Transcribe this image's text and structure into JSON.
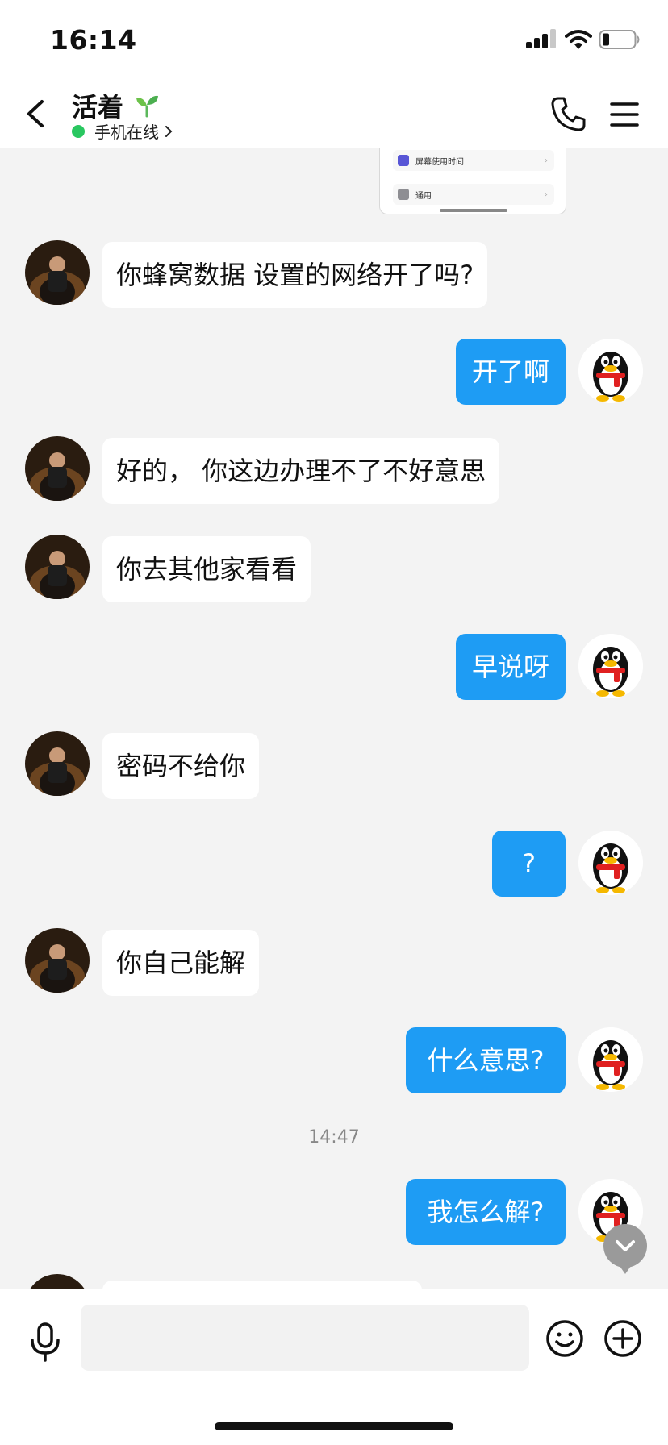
{
  "status_bar": {
    "time": "16:14"
  },
  "header": {
    "title": "活着",
    "subtitle": "手机在线"
  },
  "screenshot_preview": {
    "items": [
      "屏幕使用时间",
      "通用"
    ]
  },
  "chat": {
    "messages": [
      {
        "side": "left",
        "text": "你蜂窝数据  设置的网络开了吗?"
      },
      {
        "side": "right",
        "text": "开了啊"
      },
      {
        "side": "left",
        "text": " 好的，  你这边办理不了不好意思"
      },
      {
        "side": "left",
        "text": "你去其他家看看"
      },
      {
        "side": "right",
        "text": "早说呀"
      },
      {
        "side": "left",
        "text": "密码不给你"
      },
      {
        "side": "right",
        "text": "?"
      },
      {
        "side": "left",
        "text": " 你自己能解"
      },
      {
        "side": "right",
        "text": "什么意思?"
      },
      {
        "side": "right",
        "text": "我怎么解?"
      }
    ],
    "timestamp": "14:47"
  },
  "input": {
    "placeholder": ""
  },
  "icons": {
    "back": "chevron-left-icon",
    "phone": "phone-icon",
    "menu": "menu-icon",
    "mic": "microphone-icon",
    "emoji": "emoji-icon",
    "plus": "plus-icon",
    "scroll_down": "chevron-down-icon"
  },
  "colors": {
    "sent_bubble": "#1e9cf4",
    "received_bubble": "#ffffff",
    "chat_background": "#f3f3f3",
    "online": "#29c760"
  }
}
